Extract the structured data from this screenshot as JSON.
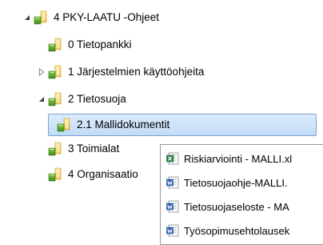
{
  "tree": {
    "items": [
      {
        "label": "4 PKY-LAATU -Ohjeet",
        "expander": "expanded"
      },
      {
        "label": "0 Tietopankki",
        "expander": "none"
      },
      {
        "label": "1 Järjestelmien käyttöohjeita",
        "expander": "collapsed"
      },
      {
        "label": "2 Tietosuoja",
        "expander": "expanded"
      },
      {
        "label": "2.1 Mallidokumentit",
        "expander": "none",
        "selected": true
      },
      {
        "label": "3 Toimialat",
        "expander": "none"
      },
      {
        "label": "4 Organisaatio",
        "expander": "none"
      }
    ]
  },
  "popup": {
    "items": [
      {
        "label": "Riskiarviointi - MALLI.xl",
        "icon": "excel-file-icon"
      },
      {
        "label": "Tietosuojaohje-MALLI.",
        "icon": "word-file-icon"
      },
      {
        "label": "Tietosuojaseloste - MA",
        "icon": "word-file-icon"
      },
      {
        "label": "Työsopimusehtolausek",
        "icon": "word-file-icon"
      }
    ]
  },
  "colors": {
    "selection_bg": "#c1dcf7",
    "selection_border": "#7da2ce",
    "folder_yellow": "#f3c94c",
    "folder_green": "#5aa02c"
  }
}
